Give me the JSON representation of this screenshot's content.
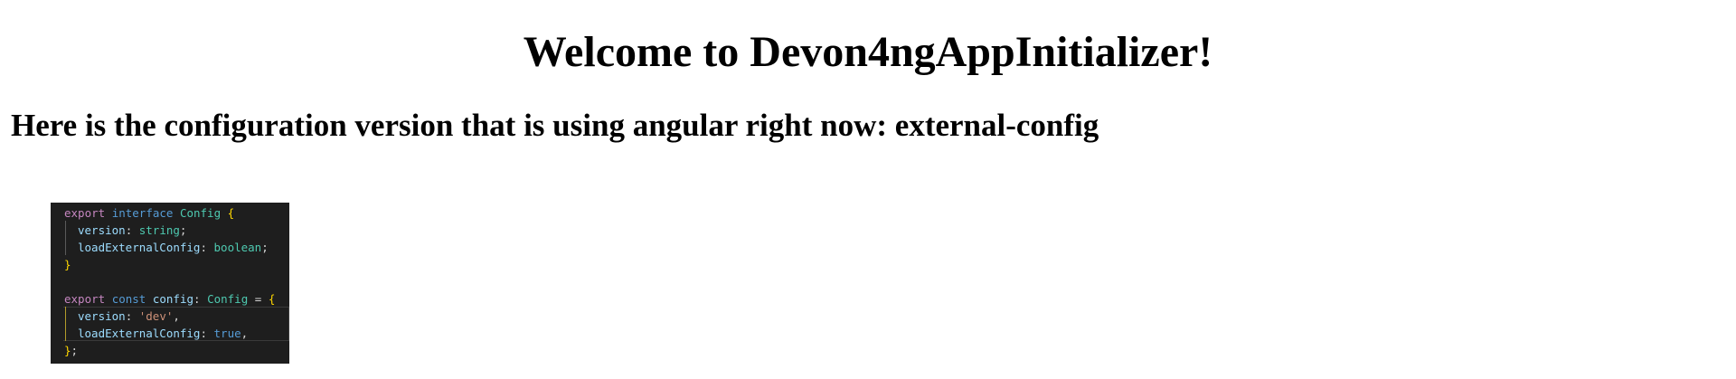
{
  "page": {
    "title": "Welcome to Devon4ngAppInitializer!",
    "subtitle": "Here is the configuration version that is using angular right now: external-config"
  },
  "code": {
    "l1": {
      "export": "export",
      "interface": "interface",
      "name": "Config",
      "brace": "{"
    },
    "l2": {
      "prop": "version",
      "colon": ": ",
      "type": "string",
      "semi": ";"
    },
    "l3": {
      "prop": "loadExternalConfig",
      "colon": ": ",
      "type": "boolean",
      "semi": ";"
    },
    "l4": {
      "brace": "}"
    },
    "l6": {
      "export": "export",
      "const": "const",
      "name": "config",
      "colon": ": ",
      "type": "Config",
      "eq": " = ",
      "brace": "{"
    },
    "l7": {
      "prop": "version",
      "colon": ": ",
      "value": "'dev'",
      "comma": ","
    },
    "l8": {
      "prop": "loadExternalConfig",
      "colon": ": ",
      "value": "true",
      "comma": ","
    },
    "l9": {
      "brace": "}",
      "semi": ";"
    }
  },
  "colors": {
    "editor_background": "#1e1e1e",
    "keyword_export": "#c586c0",
    "keyword_decl": "#569cd6",
    "type": "#4ec9b0",
    "property": "#9cdcfe",
    "brace": "#ffd700",
    "string": "#ce9178"
  }
}
